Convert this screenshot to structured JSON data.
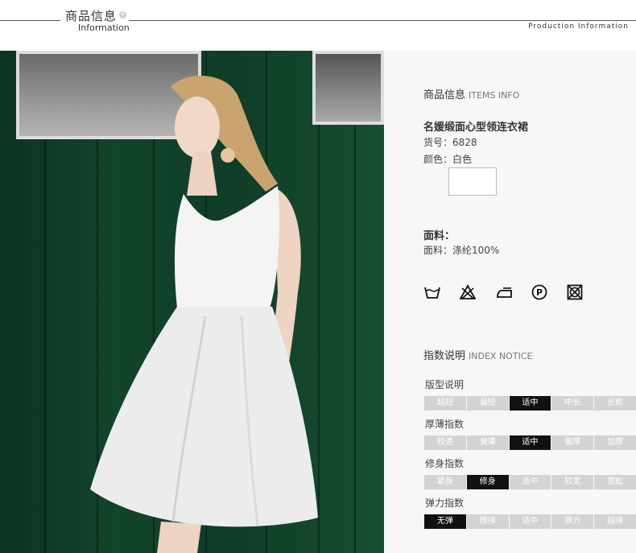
{
  "header": {
    "title": "商品信息",
    "subtitle": "Information",
    "right_text": "Production Information"
  },
  "items_info": {
    "title": "商品信息",
    "title_en": "ITEMS INFO",
    "product_name": "名媛缎面心型领连衣裙",
    "sku": "货号：6828",
    "color": "颜色：白色",
    "swatch_color": "#ffffff"
  },
  "fabric": {
    "heading": "面料：",
    "value": "面料：涤纶100%"
  },
  "care_icons": [
    "wash-tub-icon",
    "no-bleach-icon",
    "iron-icon",
    "dry-clean-p-icon",
    "no-tumble-dry-icon"
  ],
  "index_notice": {
    "title": "指数说明",
    "title_en": "INDEX NOTICE",
    "rows": [
      {
        "label": "版型说明",
        "options": [
          "超短",
          "偏短",
          "适中",
          "中长",
          "长款"
        ],
        "selected": 2
      },
      {
        "label": "厚薄指数",
        "options": [
          "较透",
          "偏薄",
          "适中",
          "偏厚",
          "加厚"
        ],
        "selected": 2
      },
      {
        "label": "修身指数",
        "options": [
          "紧身",
          "修身",
          "适中",
          "较宽",
          "宽松"
        ],
        "selected": 1
      },
      {
        "label": "弹力指数",
        "options": [
          "无弹",
          "微弹",
          "适中",
          "弹力",
          "超弹"
        ],
        "selected": 0
      }
    ]
  },
  "colors": {
    "panel_bg": "#f7f7f7",
    "selected_cell": "#111111",
    "cell": "#d3d3d3"
  }
}
